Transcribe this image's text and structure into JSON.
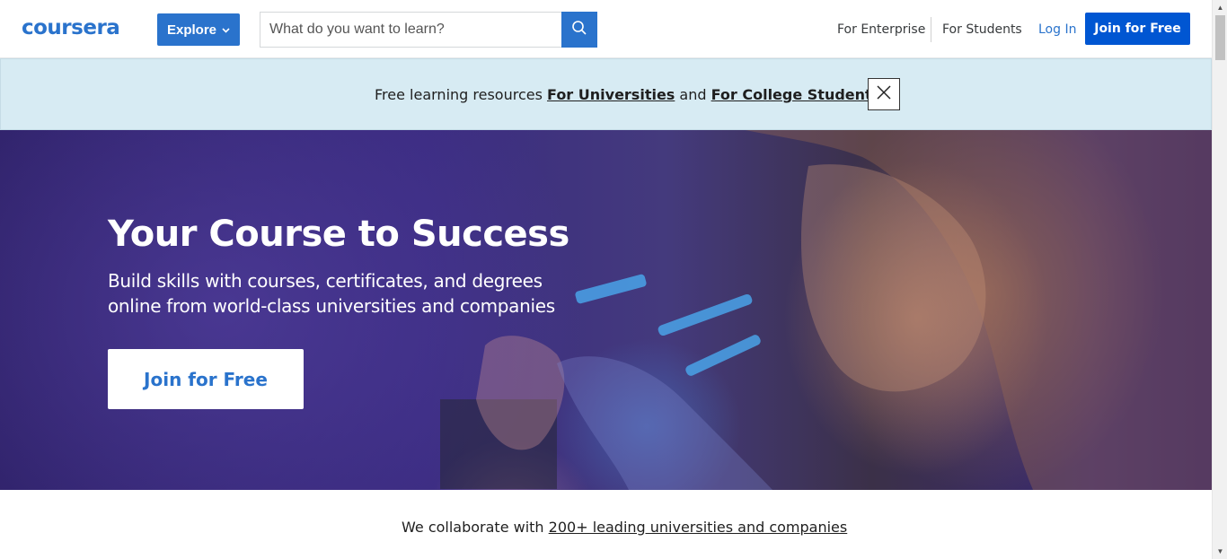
{
  "header": {
    "logo_text": "coursera",
    "explore_label": "Explore",
    "search_placeholder": "What do you want to learn?",
    "nav": {
      "enterprise": "For Enterprise",
      "students": "For Students",
      "login": "Log In",
      "join": "Join for Free"
    }
  },
  "banner": {
    "prefix": "Free learning resources ",
    "link_universities": "For Universities",
    "middle": " and ",
    "link_students": "For College Students"
  },
  "hero": {
    "title": "Your Course to Success",
    "subtitle": "Build skills with courses, certificates, and degrees online from world-class universities and companies",
    "cta": "Join for Free"
  },
  "collab": {
    "prefix": "We collaborate with ",
    "link": "200+ leading universities and companies"
  },
  "colors": {
    "brand_blue": "#2a73cc",
    "join_blue": "#0056d2",
    "banner_bg": "#d7ebf3",
    "hero_purple": "#3a2b80"
  },
  "icons": {
    "search": "search-icon",
    "close": "close-icon",
    "chevron": "chevron-down-icon"
  }
}
